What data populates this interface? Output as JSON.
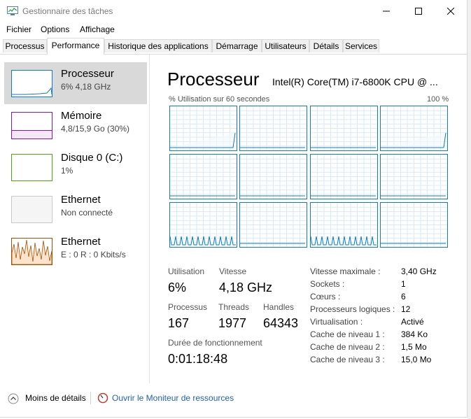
{
  "window": {
    "title": "Gestionnaire des tâches"
  },
  "menu": [
    "Fichier",
    "Options",
    "Affichage"
  ],
  "tabs": [
    "Processus",
    "Performance",
    "Historique des applications",
    "Démarrage",
    "Utilisateurs",
    "Détails",
    "Services"
  ],
  "sidebar": {
    "items": [
      {
        "name": "Processeur",
        "sub": "6% 4,18 GHz"
      },
      {
        "name": "Mémoire",
        "sub": "4,8/15,9 Go (30%)"
      },
      {
        "name": "Disque 0 (C:)",
        "sub": "1%"
      },
      {
        "name": "Ethernet",
        "sub": "Non connecté"
      },
      {
        "name": "Ethernet",
        "sub": "E : 0 R : 0 Kbits/s"
      }
    ]
  },
  "main": {
    "title": "Processeur",
    "cpu_model": "Intel(R) Core(TM) i7-6800K CPU @ ...",
    "graph_label": "% Utilisation sur 60 secondes",
    "graph_max": "100 %"
  },
  "stats": {
    "utilisation_label": "Utilisation",
    "utilisation_value": "6%",
    "vitesse_label": "Vitesse",
    "vitesse_value": "4,18 GHz",
    "processus_label": "Processus",
    "processus_value": "167",
    "threads_label": "Threads",
    "threads_value": "1977",
    "handles_label": "Handles",
    "handles_value": "64343",
    "uptime_label": "Durée de fonctionnement",
    "uptime_value": "0:01:18:48"
  },
  "info": [
    {
      "label": "Vitesse maximale :",
      "value": "3,40 GHz"
    },
    {
      "label": "Sockets :",
      "value": "1"
    },
    {
      "label": "Cœurs :",
      "value": "6"
    },
    {
      "label": "Processeurs logiques :",
      "value": "12"
    },
    {
      "label": "Virtualisation :",
      "value": "Activé"
    },
    {
      "label": "Cache de niveau 1 :",
      "value": "384 Ko"
    },
    {
      "label": "Cache de niveau 2 :",
      "value": "1,5 Mo"
    },
    {
      "label": "Cache de niveau 3 :",
      "value": "15,0 Mo"
    }
  ],
  "footer": {
    "less_details": "Moins de détails",
    "resource_monitor": "Ouvrir le Moniteur de ressources"
  },
  "colors": {
    "cpu": "#117dbb",
    "memory": "#8b12ae",
    "disk": "#4da60c",
    "ethernet_active": "#a74f01",
    "ethernet_inactive": "#c8c8c8"
  }
}
